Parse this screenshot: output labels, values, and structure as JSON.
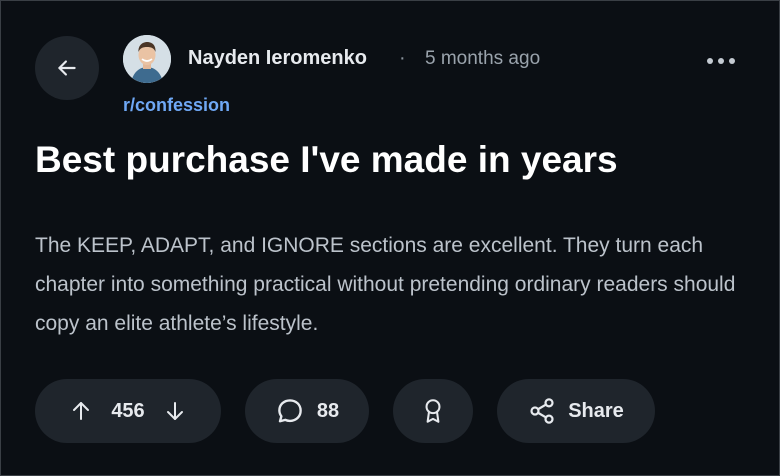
{
  "post": {
    "author": "Nayden Ieromenko",
    "separator": "·",
    "time": "5 months ago",
    "subreddit": "r/confession",
    "title": "Best purchase I've made in years",
    "body": "The KEEP, ADAPT, and IGNORE sections are excellent. They turn each chapter into something practical without pretending ordinary readers should copy an elite athlete’s lifestyle."
  },
  "actions": {
    "vote_count": "456",
    "comment_count": "88",
    "share_label": "Share"
  },
  "icons": {
    "back": "arrow-left-icon",
    "more": "more-horizontal-icon",
    "upvote": "arrow-up-icon",
    "downvote": "arrow-down-icon",
    "comment": "comment-bubble-icon",
    "award": "award-ribbon-icon",
    "share": "share-nodes-icon"
  },
  "colors": {
    "background": "#0b0f14",
    "pill": "#1f252c",
    "subreddit_link": "#6fa8f5",
    "title": "#ffffff",
    "body_text": "#bcc3cb"
  }
}
